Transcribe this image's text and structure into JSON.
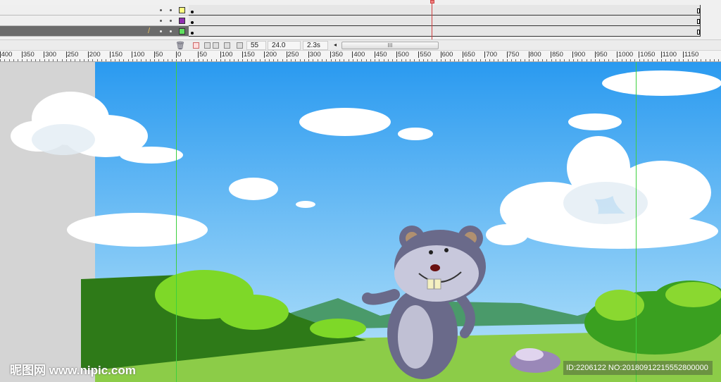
{
  "timeline": {
    "layers": [
      {
        "color": "#ffff80",
        "selected": false
      },
      {
        "color": "#9030b0",
        "selected": false
      },
      {
        "color": "#60e060",
        "selected": true
      }
    ],
    "current_frame": "55",
    "fps": "24.0 fps",
    "elapsed": "2.3s",
    "scroll_grip": "III"
  },
  "ruler": {
    "labels": [
      "400",
      "350",
      "300",
      "250",
      "200",
      "150",
      "100",
      "50",
      "0",
      "50",
      "100",
      "150",
      "200",
      "250",
      "300",
      "350",
      "400",
      "450",
      "500",
      "550",
      "600",
      "650",
      "700",
      "750",
      "800",
      "850",
      "900",
      "950",
      "1000",
      "1050",
      "1100",
      "1150"
    ]
  },
  "watermark": {
    "logo": "昵图网 www.nipic.com",
    "id_text": "ID:2206122 NO:20180912215552800000"
  }
}
